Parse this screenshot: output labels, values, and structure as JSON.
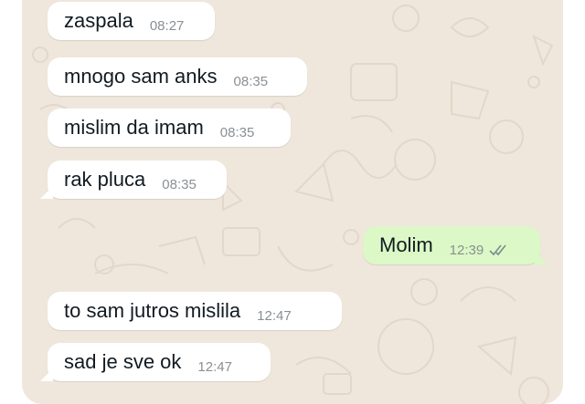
{
  "colors": {
    "wallpaper": "#efe7dc",
    "incoming_bubble": "#ffffff",
    "outgoing_bubble": "#dcf8c6",
    "timestamp": "#8a8f93",
    "read_ticks": "#7d8a8f"
  },
  "messages": [
    {
      "direction": "incoming",
      "text": "zaspala",
      "time": "08:27"
    },
    {
      "direction": "incoming",
      "text": "mnogo sam anks",
      "time": "08:35"
    },
    {
      "direction": "incoming",
      "text": "mislim da imam",
      "time": "08:35"
    },
    {
      "direction": "incoming",
      "text": "rak pluca",
      "time": "08:35"
    },
    {
      "direction": "outgoing",
      "text": "Molim",
      "time": "12:39",
      "status_icon": "double-check-icon"
    },
    {
      "direction": "incoming",
      "text": "to sam jutros mislila",
      "time": "12:47"
    },
    {
      "direction": "incoming",
      "text": "sad je sve ok",
      "time": "12:47"
    }
  ]
}
